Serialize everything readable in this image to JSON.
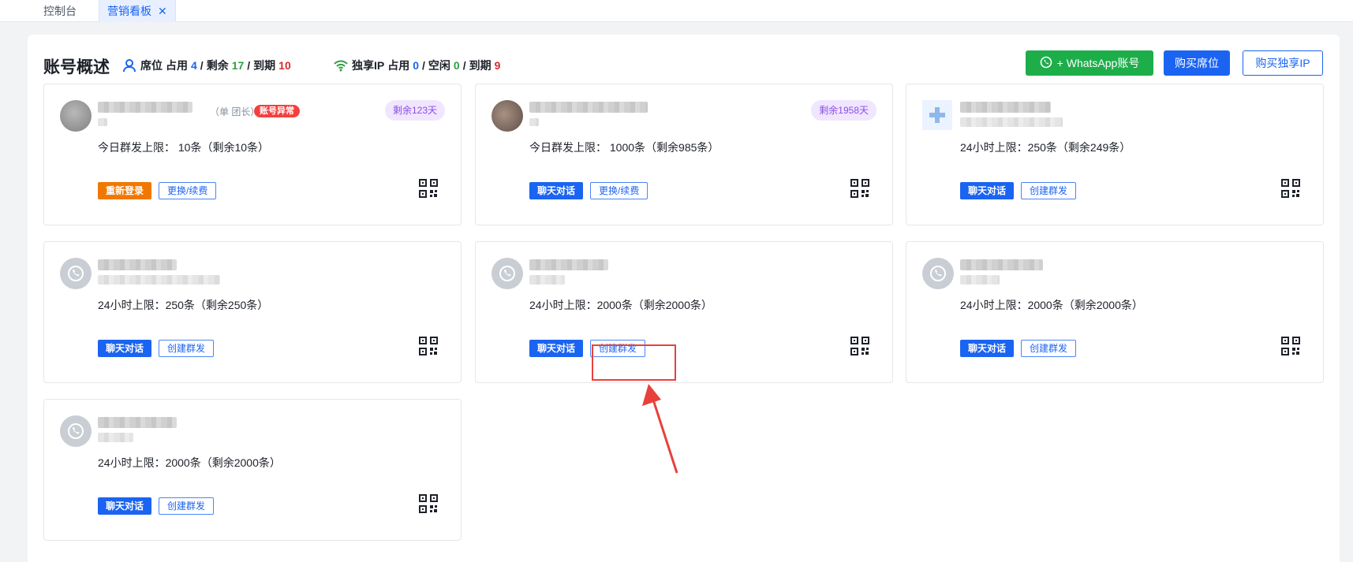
{
  "tabs": [
    {
      "label": "控制台"
    },
    {
      "label": "营销看板",
      "active": true
    }
  ],
  "header": {
    "title": "账号概述",
    "seat": {
      "label": "席位",
      "occupied_label": "占用",
      "occupied": "4",
      "remaining_label": "剩余",
      "remaining": "17",
      "expired_label": "到期",
      "expired": "10"
    },
    "ip": {
      "label": "独享IP",
      "occupied_label": "占用",
      "occupied": "0",
      "idle_label": "空闲",
      "idle": "0",
      "expired_label": "到期",
      "expired": "9"
    },
    "buttons": {
      "add_whatsapp": "+ WhatsApp账号",
      "buy_seat": "购买席位",
      "buy_ip": "购买独享IP"
    }
  },
  "cards": [
    {
      "role": "（单 团长）",
      "badge": "账号异常",
      "days": "剩余123天",
      "limit": "今日群发上限： 10条（剩余10条）",
      "btn1": "重新登录",
      "btn2": "更换/续费"
    },
    {
      "days": "剩余1958天",
      "limit": "今日群发上限： 1000条（剩余985条）",
      "btn1": "聊天对话",
      "btn2": "更换/续费"
    },
    {
      "limit": "24小时上限：250条（剩余249条）",
      "btn1": "聊天对话",
      "btn2": "创建群发"
    },
    {
      "limit": "24小时上限：250条（剩余250条）",
      "btn1": "聊天对话",
      "btn2": "创建群发"
    },
    {
      "limit": "24小时上限：2000条（剩余2000条）",
      "btn1": "聊天对话",
      "btn2": "创建群发"
    },
    {
      "limit": "24小时上限：2000条（剩余2000条）",
      "btn1": "聊天对话",
      "btn2": "创建群发"
    },
    {
      "limit": "24小时上限：2000条（剩余2000条）",
      "btn1": "聊天对话",
      "btn2": "创建群发"
    }
  ],
  "colors": {
    "primary": "#1b64f2",
    "whatsapp": "#1dae4a",
    "danger": "#f53f3f",
    "orange": "#f07800",
    "highlight": "#e8413c"
  },
  "icons": [
    "user-icon",
    "wifi-icon",
    "whatsapp-icon",
    "qr-code-icon",
    "close-icon",
    "arrow-icon"
  ]
}
